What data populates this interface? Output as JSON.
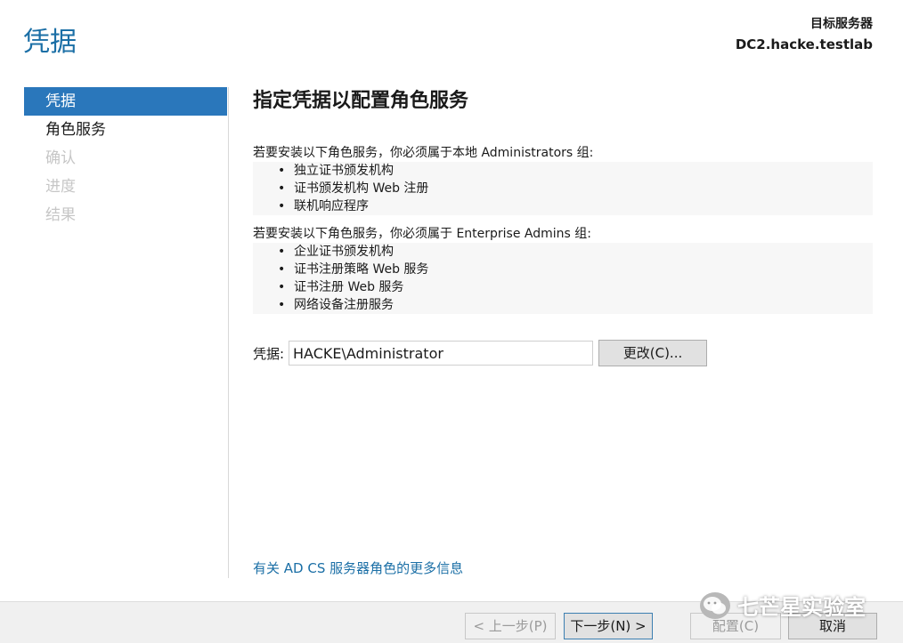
{
  "page": {
    "title": "凭据",
    "target_label": "目标服务器",
    "target_value": "DC2.hacke.testlab"
  },
  "nav": {
    "items": [
      {
        "label": "凭据",
        "state": "active"
      },
      {
        "label": "角色服务",
        "state": "normal"
      },
      {
        "label": "确认",
        "state": "disabled"
      },
      {
        "label": "进度",
        "state": "disabled"
      },
      {
        "label": "结果",
        "state": "disabled"
      }
    ]
  },
  "content": {
    "heading": "指定凭据以配置角色服务",
    "local_admin_text": "若要安装以下角色服务，你必须属于本地 Administrators 组:",
    "local_admin_list": [
      "独立证书颁发机构",
      "证书颁发机构 Web 注册",
      "联机响应程序"
    ],
    "enterprise_admin_text": "若要安装以下角色服务，你必须属于 Enterprise Admins 组:",
    "enterprise_admin_list": [
      "企业证书颁发机构",
      "证书注册策略 Web 服务",
      "证书注册 Web 服务",
      "网络设备注册服务"
    ],
    "credential_label": "凭据:",
    "credential_value": "HACKE\\Administrator",
    "change_button": "更改(C)...",
    "more_info_link": "有关 AD CS 服务器角色的更多信息"
  },
  "footer": {
    "prev_button": "< 上一步(P)",
    "next_button": "下一步(N) >",
    "configure_button": "配置(C)",
    "cancel_button": "取消"
  },
  "watermark": {
    "text": "七芒星实验室"
  },
  "colors": {
    "accent": "#2a77bb",
    "title": "#1b6fa6",
    "disabled": "#c6c6c6"
  }
}
